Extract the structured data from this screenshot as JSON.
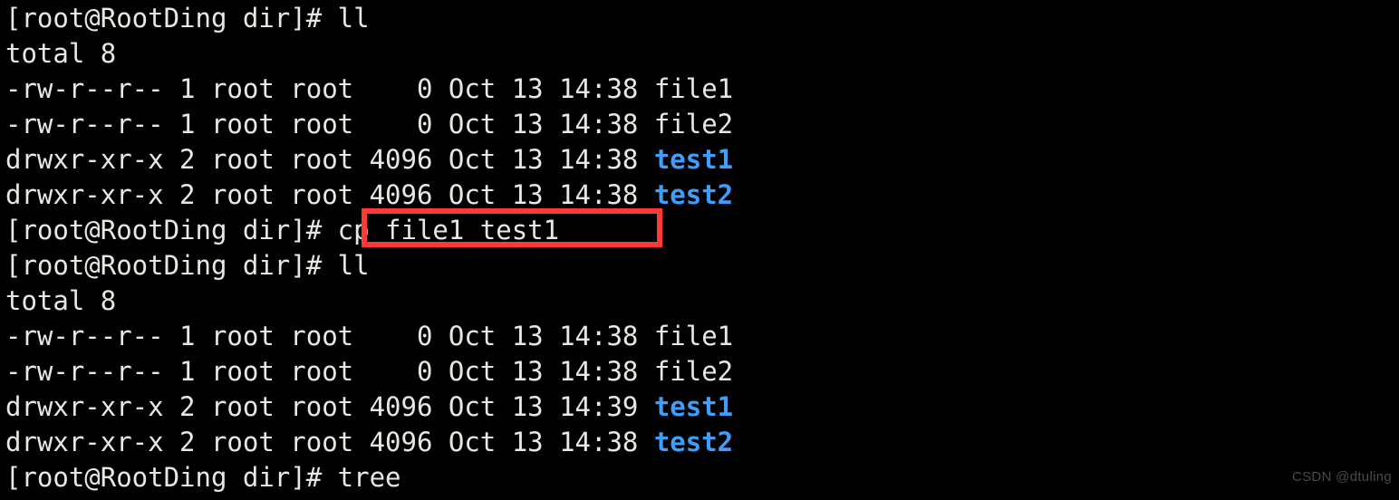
{
  "terminal": {
    "background_color": "#000000",
    "foreground_color": "#e8e8e3",
    "directory_color": "#3f9dfc",
    "highlight_color": "#f93a35",
    "prompt": "[root@RootDing dir]# ",
    "lines": [
      {
        "id": "line-1",
        "kind": "prompt-command",
        "segments": [
          {
            "text": "[root@RootDing dir]# ll",
            "style": "default"
          }
        ]
      },
      {
        "id": "line-2",
        "kind": "output",
        "segments": [
          {
            "text": "total 8",
            "style": "default"
          }
        ]
      },
      {
        "id": "line-3",
        "kind": "listing-file",
        "segments": [
          {
            "text": "-rw-r--r-- 1 root root    0 Oct 13 14:38 file1",
            "style": "default"
          }
        ]
      },
      {
        "id": "line-4",
        "kind": "listing-file",
        "segments": [
          {
            "text": "-rw-r--r-- 1 root root    0 Oct 13 14:38 file2",
            "style": "default"
          }
        ]
      },
      {
        "id": "line-5",
        "kind": "listing-dir",
        "segments": [
          {
            "text": "drwxr-xr-x 2 root root 4096 Oct 13 14:38 ",
            "style": "default"
          },
          {
            "text": "test1",
            "style": "dir"
          }
        ]
      },
      {
        "id": "line-6",
        "kind": "listing-dir",
        "segments": [
          {
            "text": "drwxr-xr-x 2 root root 4096 Oct 13 14:38 ",
            "style": "default"
          },
          {
            "text": "test2",
            "style": "dir"
          }
        ]
      },
      {
        "id": "line-7",
        "kind": "prompt-command",
        "segments": [
          {
            "text": "[root@RootDing dir]# cp file1 test1",
            "style": "default"
          }
        ]
      },
      {
        "id": "line-8",
        "kind": "prompt-command",
        "segments": [
          {
            "text": "[root@RootDing dir]# ll",
            "style": "default"
          }
        ]
      },
      {
        "id": "line-9",
        "kind": "output",
        "segments": [
          {
            "text": "total 8",
            "style": "default"
          }
        ]
      },
      {
        "id": "line-10",
        "kind": "listing-file",
        "segments": [
          {
            "text": "-rw-r--r-- 1 root root    0 Oct 13 14:38 file1",
            "style": "default"
          }
        ]
      },
      {
        "id": "line-11",
        "kind": "listing-file",
        "segments": [
          {
            "text": "-rw-r--r-- 1 root root    0 Oct 13 14:38 file2",
            "style": "default"
          }
        ]
      },
      {
        "id": "line-12",
        "kind": "listing-dir",
        "segments": [
          {
            "text": "drwxr-xr-x 2 root root 4096 Oct 13 14:39 ",
            "style": "default"
          },
          {
            "text": "test1",
            "style": "dir"
          }
        ]
      },
      {
        "id": "line-13",
        "kind": "listing-dir",
        "segments": [
          {
            "text": "drwxr-xr-x 2 root root 4096 Oct 13 14:38 ",
            "style": "default"
          },
          {
            "text": "test2",
            "style": "dir"
          }
        ]
      },
      {
        "id": "line-14",
        "kind": "prompt-command",
        "segments": [
          {
            "text": "[root@RootDing dir]# tree",
            "style": "default"
          }
        ]
      }
    ],
    "highlight": {
      "label": "cp file1 test1",
      "line_id": "line-7"
    }
  },
  "watermark": {
    "text": "CSDN @dtuling"
  }
}
